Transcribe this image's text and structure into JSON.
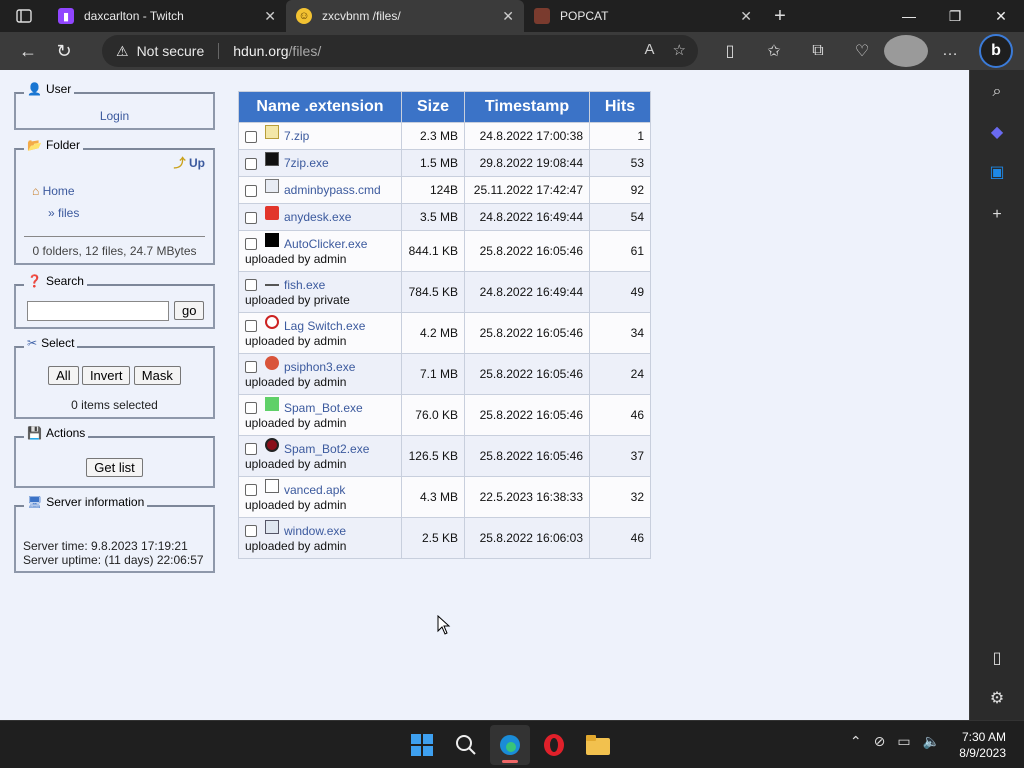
{
  "browser": {
    "tabs": [
      {
        "title": "daxcarlton - Twitch",
        "icon": "twitch-icon",
        "color": "#9146ff"
      },
      {
        "title": "zxcvbnm /files/",
        "icon": "smiley-icon",
        "color": "#f2c232"
      },
      {
        "title": "POPCAT",
        "icon": "popcat-icon",
        "color": "#7a3b2e"
      }
    ],
    "security_label": "Not secure",
    "url_host": "hdun.org",
    "url_path": "/files/"
  },
  "sidebar": {
    "user": {
      "title": "User",
      "login": "Login"
    },
    "folder": {
      "title": "Folder",
      "up": "Up",
      "home": "Home",
      "current": "» files",
      "summary": "0 folders, 12 files, 24.7 MBytes"
    },
    "search": {
      "title": "Search",
      "go": "go"
    },
    "select": {
      "title": "Select",
      "all": "All",
      "invert": "Invert",
      "mask": "Mask",
      "status": "0 items selected"
    },
    "actions": {
      "title": "Actions",
      "get_list": "Get list"
    },
    "server": {
      "title": "Server information",
      "time": "Server time: 9.8.2023 17:19:21",
      "uptime": "Server uptime: (11 days) 22:06:57"
    }
  },
  "table": {
    "headers": [
      "Name .extension",
      "Size",
      "Timestamp",
      "Hits"
    ],
    "rows": [
      {
        "name": "7.zip",
        "uploader": "",
        "size": "2.3 MB",
        "timestamp": "24.8.2022 17:00:38",
        "hits": "1",
        "icon": "zip-icon"
      },
      {
        "name": "7zip.exe",
        "uploader": "",
        "size": "1.5 MB",
        "timestamp": "29.8.2022 19:08:44",
        "hits": "53",
        "icon": "7zip-icon"
      },
      {
        "name": "adminbypass.cmd",
        "uploader": "",
        "size": "124B",
        "timestamp": "25.11.2022 17:42:47",
        "hits": "92",
        "icon": "cmd-icon"
      },
      {
        "name": "anydesk.exe",
        "uploader": "",
        "size": "3.5 MB",
        "timestamp": "24.8.2022 16:49:44",
        "hits": "54",
        "icon": "anydesk-icon"
      },
      {
        "name": "AutoClicker.exe",
        "uploader": "uploaded by admin",
        "size": "844.1 KB",
        "timestamp": "25.8.2022 16:05:46",
        "hits": "61",
        "icon": "autoclicker-icon"
      },
      {
        "name": "fish.exe",
        "uploader": "uploaded by private",
        "size": "784.5 KB",
        "timestamp": "24.8.2022 16:49:44",
        "hits": "49",
        "icon": "fish-icon"
      },
      {
        "name": "Lag Switch.exe",
        "uploader": "uploaded by admin",
        "size": "4.2 MB",
        "timestamp": "25.8.2022 16:05:46",
        "hits": "34",
        "icon": "lagswitch-icon"
      },
      {
        "name": "psiphon3.exe",
        "uploader": "uploaded by admin",
        "size": "7.1 MB",
        "timestamp": "25.8.2022 16:05:46",
        "hits": "24",
        "icon": "psiphon-icon"
      },
      {
        "name": "Spam_Bot.exe",
        "uploader": "uploaded by admin",
        "size": "76.0 KB",
        "timestamp": "25.8.2022 16:05:46",
        "hits": "46",
        "icon": "spambot-icon"
      },
      {
        "name": "Spam_Bot2.exe",
        "uploader": "uploaded by admin",
        "size": "126.5 KB",
        "timestamp": "25.8.2022 16:05:46",
        "hits": "37",
        "icon": "spambot2-icon"
      },
      {
        "name": "vanced.apk",
        "uploader": "uploaded by admin",
        "size": "4.3 MB",
        "timestamp": "22.5.2023 16:38:33",
        "hits": "32",
        "icon": "file-icon"
      },
      {
        "name": "window.exe",
        "uploader": "uploaded by admin",
        "size": "2.5 KB",
        "timestamp": "25.8.2022 16:06:03",
        "hits": "46",
        "icon": "window-icon"
      }
    ]
  },
  "taskbar": {
    "time": "7:30 AM",
    "date": "8/9/2023"
  },
  "colors": {
    "header_blue": "#3b73c7",
    "link": "#3c5a9e",
    "page_bg": "#eef2fb"
  }
}
